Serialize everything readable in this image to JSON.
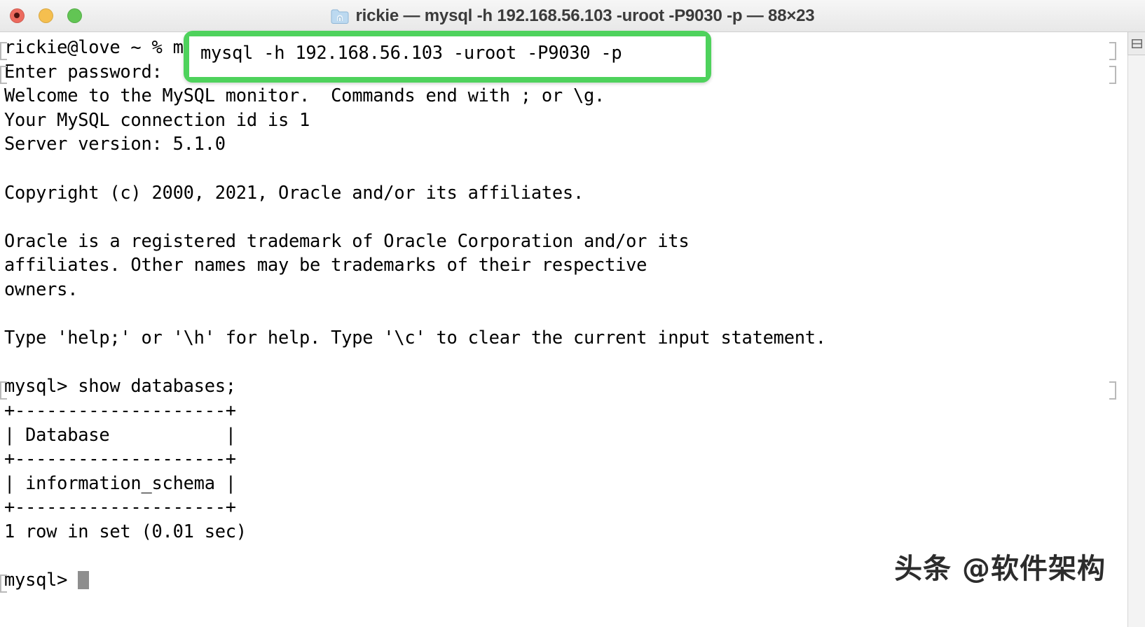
{
  "window": {
    "title": "rickie — mysql -h 192.168.56.103 -uroot -P9030 -p — 88×23",
    "traffic_lights": {
      "close_label": "close",
      "minimize_label": "minimize",
      "zoom_label": "zoom"
    },
    "folder_icon": "folder-icon",
    "split_icon": "split-pane-icon"
  },
  "terminal": {
    "prompt_shell": "rickie@love ~ % ",
    "command_highlighted": "mysql -h 192.168.56.103 -uroot -P9030 -p",
    "lines": [
      "rickie@love ~ % mysql -h 192.168.56.103 -uroot -P9030 -p",
      "Enter password:",
      "Welcome to the MySQL monitor.  Commands end with ; or \\g.",
      "Your MySQL connection id is 1",
      "Server version: 5.1.0",
      "",
      "Copyright (c) 2000, 2021, Oracle and/or its affiliates.",
      "",
      "Oracle is a registered trademark of Oracle Corporation and/or its",
      "affiliates. Other names may be trademarks of their respective",
      "owners.",
      "",
      "Type 'help;' or '\\h' for help. Type '\\c' to clear the current input statement.",
      "",
      "mysql> show databases;",
      "+--------------------+",
      "| Database           |",
      "+--------------------+",
      "| information_schema |",
      "+--------------------+",
      "1 row in set (0.01 sec)",
      "",
      "mysql> "
    ],
    "result_table": {
      "type": "table",
      "columns": [
        "Database"
      ],
      "rows": [
        [
          "information_schema"
        ]
      ],
      "row_count_text": "1 row in set (0.01 sec)"
    },
    "cursor": "block-cursor",
    "server_version": "5.1.0",
    "connection_id": "1",
    "host": "192.168.56.103",
    "port": "9030",
    "user": "root"
  },
  "annotation": {
    "highlight_color": "#4ed25c",
    "highlight_target": "mysql -h 192.168.56.103 -uroot -P9030 -p"
  },
  "watermark": {
    "text": "头条 @软件架构"
  }
}
